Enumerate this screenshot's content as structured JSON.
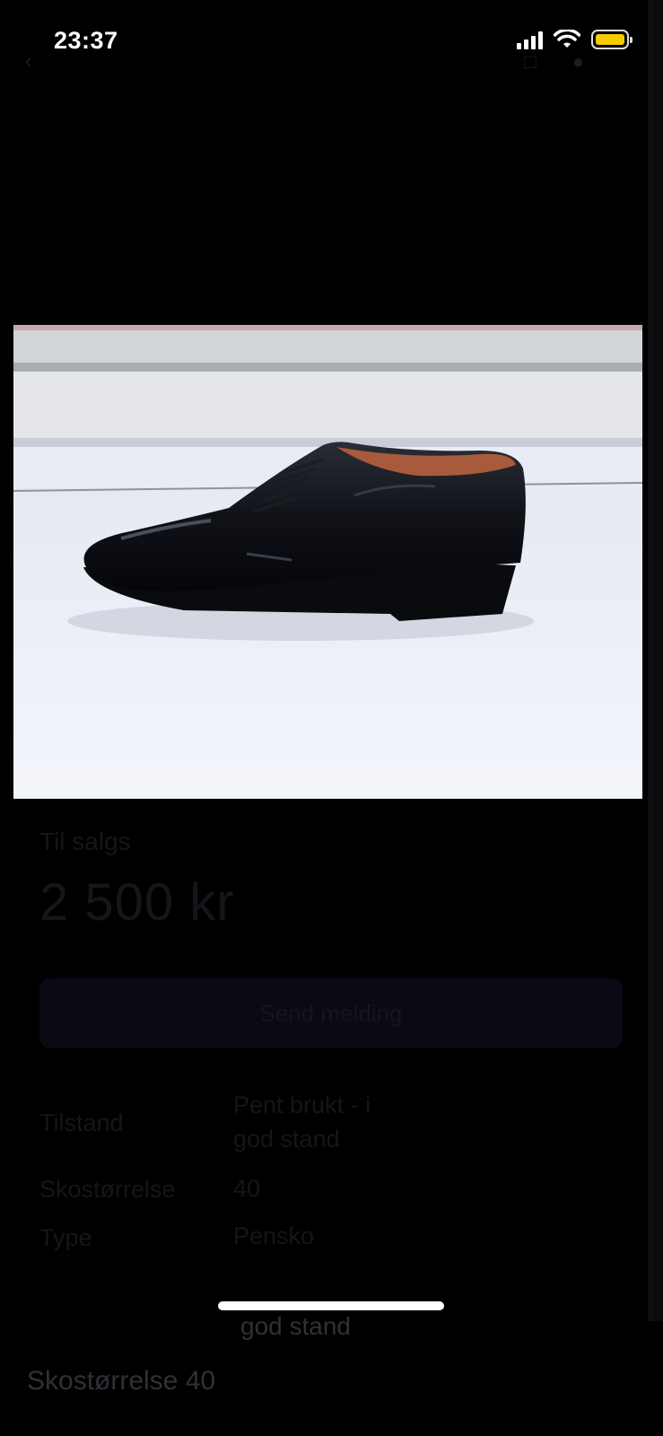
{
  "status_bar": {
    "time": "23:37"
  },
  "listing": {
    "sale_label": "Til salgs",
    "price": "2 500 kr",
    "message_button": "Send melding",
    "details": [
      {
        "label": "Tilstand",
        "value_line1": "Pent brukt - i",
        "value_line2": "god stand"
      },
      {
        "label": "Skostørrelse",
        "value_line1": "40"
      },
      {
        "label": "Type",
        "value_line1": "Pensko"
      }
    ]
  },
  "bottom": {
    "repeat_value": "god stand",
    "repeat_label": "Skostørrelse 40"
  },
  "colors": {
    "battery": "#f5cd00",
    "background": "#000000"
  }
}
